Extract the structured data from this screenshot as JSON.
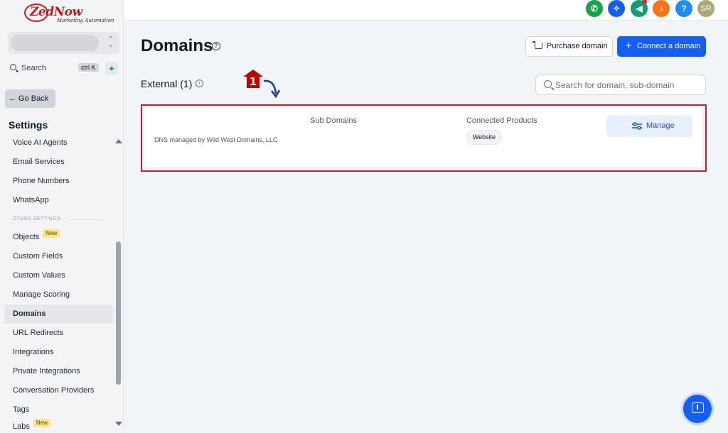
{
  "brand": {
    "name": "ZedNow",
    "tagline": "Marketing Automation",
    "color": "#b91c1c"
  },
  "sidebar": {
    "search_label": "Search",
    "search_shortcut": "ctrl K",
    "go_back": "← Go Back",
    "settings_title": "Settings",
    "items": [
      {
        "label": "Voice AI Agents"
      },
      {
        "label": "Email Services"
      },
      {
        "label": "Phone Numbers"
      },
      {
        "label": "WhatsApp"
      }
    ],
    "other_settings_label": "OTHER SETTINGS",
    "other_items": [
      {
        "label": "Objects",
        "badge": "New"
      },
      {
        "label": "Custom Fields"
      },
      {
        "label": "Custom Values"
      },
      {
        "label": "Manage Scoring"
      },
      {
        "label": "Domains",
        "active": true
      },
      {
        "label": "URL Redirects"
      },
      {
        "label": "Integrations"
      },
      {
        "label": "Private Integrations"
      },
      {
        "label": "Conversation Providers"
      },
      {
        "label": "Tags"
      },
      {
        "label": "Labs",
        "badge": "New"
      }
    ]
  },
  "topbar": {
    "buttons": [
      {
        "icon": "phone-icon",
        "color": "#16a34a"
      },
      {
        "icon": "magic-icon",
        "color": "#155eef"
      },
      {
        "icon": "megaphone-icon",
        "color": "#0f9d74"
      },
      {
        "icon": "bell-icon",
        "color": "#f97316"
      },
      {
        "icon": "help-icon",
        "color": "#1d8cf8",
        "label": "?"
      }
    ],
    "avatar_initials": "SR",
    "avatar_color": "#a8a878"
  },
  "main": {
    "title": "Domains",
    "purchase_button": "Purchase domain",
    "connect_button": "Connect a domain",
    "section_title": "External (1)",
    "search_placeholder": "Search for domain, sub-domain",
    "annotation_step": "1",
    "card": {
      "sub_domains_header": "Sub Domains",
      "connected_products_header": "Connected Products",
      "dns_text": "DNS managed by Wild West Domains, LLC",
      "product_chip": "Website",
      "manage_button": "Manage"
    },
    "accent": "#155eef",
    "highlight_color": "#c81e2c"
  }
}
